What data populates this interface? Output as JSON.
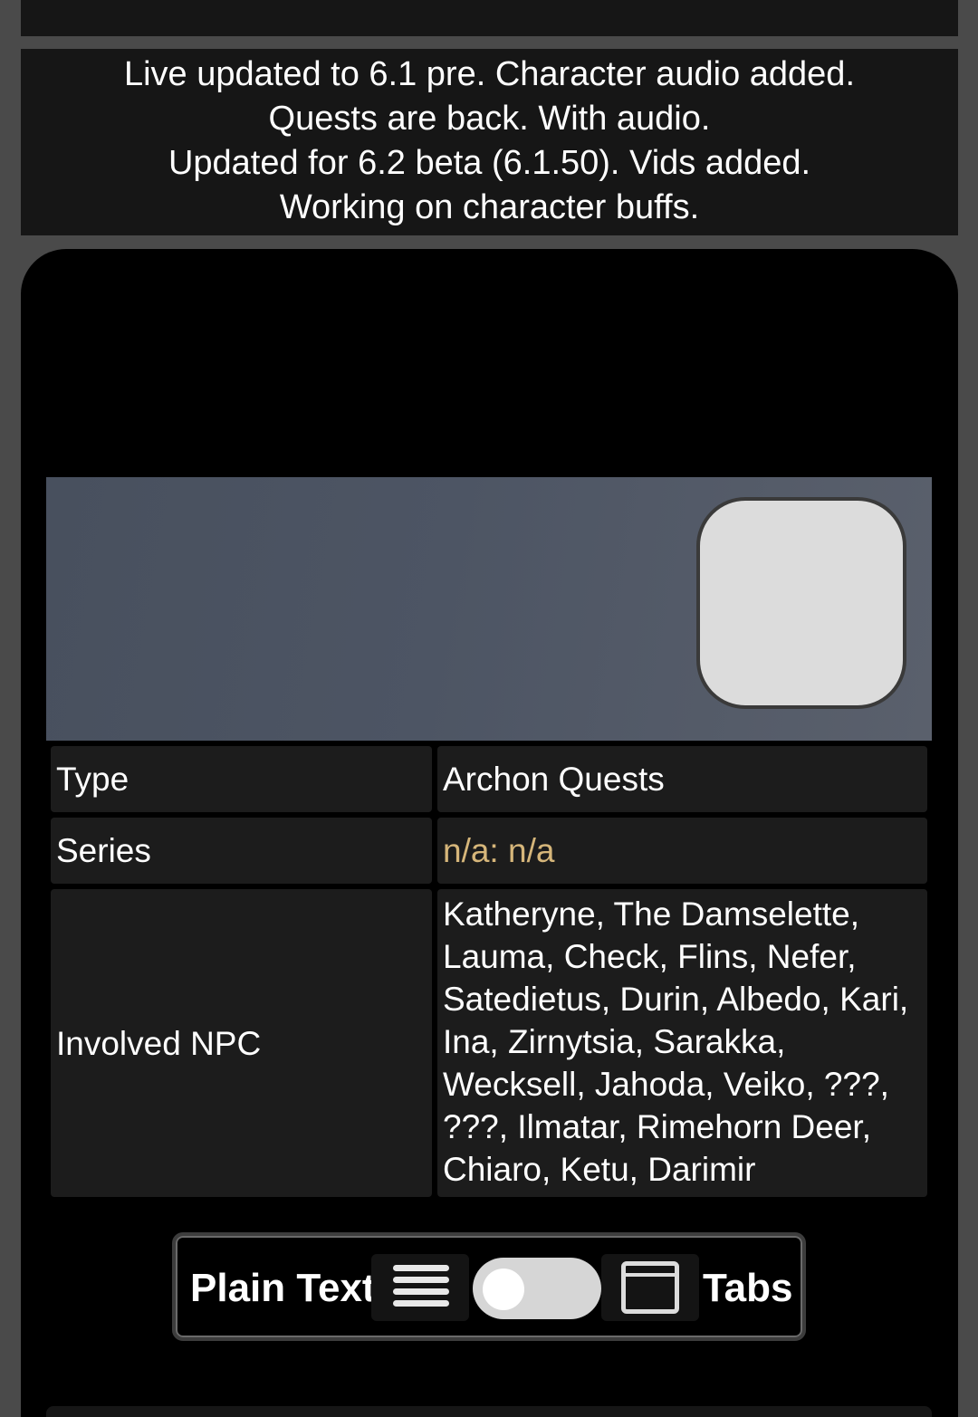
{
  "notice": {
    "lines": [
      "Live updated to 6.1 pre. Character audio added.",
      "Quests are back. With audio.",
      "Updated for 6.2 beta (6.1.50). Vids added.",
      "Working on character buffs."
    ]
  },
  "banner": {
    "icon": "blank-rounded-square-icon"
  },
  "info": {
    "type_label": "Type",
    "type_value": "Archon Quests",
    "series_label": "Series",
    "series_value": "n/a: n/a",
    "npc_label": "Involved NPC",
    "npc_lines": [
      "Katheryne, The Damselette,",
      "Lauma, Check, Flins, Nefer,",
      "Satedietus, Durin, Albedo, Kari,",
      "Ina, Zirnytsia, Sarakka,",
      "Wecksell, Jahoda, Veiko, ???,",
      "???, Ilmatar, Rimehorn Deer,",
      "Chiaro, Ketu, Darimir"
    ]
  },
  "view_toggle": {
    "left_label": "Plain Text",
    "left_icon": "list-icon",
    "right_label": "Tabs",
    "right_icon": "tab-window-icon",
    "state": "plain-text"
  },
  "colors": {
    "page_bg": "#4a4a4a",
    "panel_bg": "#161616",
    "cell_bg": "#1c1c1c",
    "link_gold": "#d6b67a",
    "switch_track": "#d6d6d6"
  }
}
